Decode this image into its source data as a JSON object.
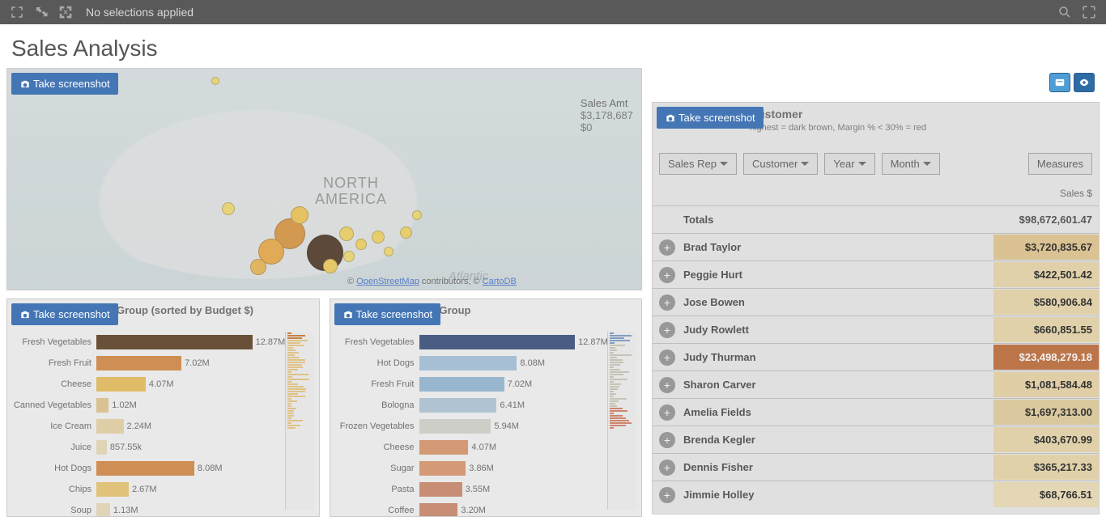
{
  "topbar": {
    "status": "No selections applied"
  },
  "page_title": "Sales Analysis",
  "screenshot_label": "Take screenshot",
  "map": {
    "na_label_1": "NORTH",
    "na_label_2": "AMERICA",
    "atl_label": "Atlantic",
    "legend_title": "Sales Amt",
    "legend_max": "$3,178,687",
    "legend_min": "$0",
    "attrib_prefix": "© ",
    "attrib_link1": "OpenStreetMap",
    "attrib_mid": " contributors, © ",
    "attrib_link2": "CartoDB"
  },
  "chart_lhs_title": "Group (sorted by Budget $)",
  "chart_rhs_title": "Group",
  "chart_data": [
    {
      "type": "bar",
      "orientation": "horizontal",
      "title": "Group (sorted by Budget $)",
      "categories": [
        "Fresh Vegetables",
        "Fresh Fruit",
        "Cheese",
        "Canned Vegetables",
        "Ice Cream",
        "Juice",
        "Hot Dogs",
        "Chips",
        "Soup"
      ],
      "values": [
        12.87,
        7.02,
        4.07,
        1.02,
        2.24,
        0.85755,
        8.08,
        2.67,
        1.13
      ],
      "value_labels": [
        "12.87M",
        "7.02M",
        "4.07M",
        "1.02M",
        "2.24M",
        "857.55k",
        "8.08M",
        "2.67M",
        "1.13M"
      ],
      "colors": [
        "#4a2a0a",
        "#d27b2c",
        "#e8b84a",
        "#e0c080",
        "#e8d09c",
        "#e8d8b0",
        "#d27b2c",
        "#e8c060",
        "#e8d8b0"
      ],
      "xlim": [
        0,
        15
      ]
    },
    {
      "type": "bar",
      "orientation": "horizontal",
      "title": "Group",
      "categories": [
        "Fresh Vegetables",
        "Hot Dogs",
        "Fresh Fruit",
        "Bologna",
        "Frozen Vegetables",
        "Cheese",
        "Sugar",
        "Pasta",
        "Coffee"
      ],
      "values": [
        12.87,
        8.08,
        7.02,
        6.41,
        5.94,
        4.07,
        3.86,
        3.55,
        3.2
      ],
      "value_labels": [
        "12.87M",
        "8.08M",
        "7.02M",
        "6.41M",
        "5.94M",
        "4.07M",
        "3.86M",
        "3.55M",
        "3.20M"
      ],
      "colors": [
        "#1f3a6e",
        "#9bbdd8",
        "#88b0d0",
        "#a8c2d6",
        "#d0d0c8",
        "#d88a5a",
        "#d88a5a",
        "#c87a5a",
        "#c87a5a"
      ],
      "xlim": [
        0,
        15
      ]
    }
  ],
  "table": {
    "title": "Customer",
    "subtitle": "highest = dark brown, Margin % < 30% = red",
    "dims": [
      "Sales Rep",
      "Customer",
      "Year",
      "Month"
    ],
    "measures_label": "Measures",
    "col_header": "Sales $",
    "totals_label": "Totals",
    "totals_value": "$98,672,601.47",
    "rows": [
      {
        "name": "Brad Taylor",
        "value": "$3,720,835.67",
        "shade": "#e0c080"
      },
      {
        "name": "Peggie Hurt",
        "value": "$422,501.42",
        "shade": "#e8d4a0"
      },
      {
        "name": "Jose Bowen",
        "value": "$580,906.84",
        "shade": "#e8d4a0"
      },
      {
        "name": "Judy Rowlett",
        "value": "$660,851.55",
        "shade": "#e8d4a0"
      },
      {
        "name": "Judy Thurman",
        "value": "$23,498,279.18",
        "shade": "#b85a1f",
        "dark": true
      },
      {
        "name": "Sharon Carver",
        "value": "$1,081,584.48",
        "shade": "#e8d09c"
      },
      {
        "name": "Amelia Fields",
        "value": "$1,697,313.00",
        "shade": "#e0c890"
      },
      {
        "name": "Brenda Kegler",
        "value": "$403,670.99",
        "shade": "#e8d4a0"
      },
      {
        "name": "Dennis Fisher",
        "value": "$365,217.33",
        "shade": "#e8d4a0"
      },
      {
        "name": "Jimmie Holley",
        "value": "$68,766.51",
        "shade": "#ecdcb0"
      }
    ]
  }
}
